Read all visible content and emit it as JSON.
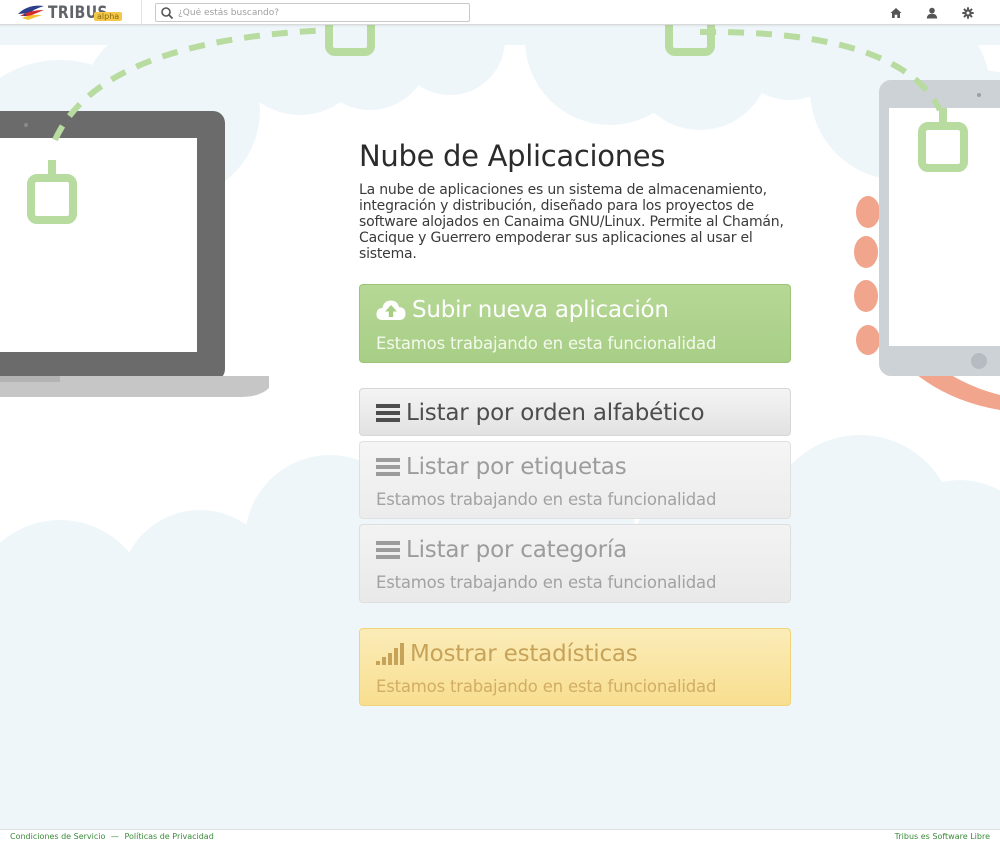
{
  "navbar": {
    "brand_name": "TRIBUS",
    "brand_badge": "alpha",
    "search_placeholder": "¿Qué estás buscando?",
    "icons": [
      "home-icon",
      "user-icon",
      "gear-icon"
    ]
  },
  "main": {
    "title": "Nube de Aplicaciones",
    "description": "La nube de aplicaciones es un sistema de almacenamiento, integración y distribución, diseñado para los proyectos de software alojados en Canaima GNU/Linux. Permite al Chamán, Cacique y Guerrero empoderar sus aplicaciones al usar el sistema.",
    "tiles": [
      {
        "label": "Subir nueva aplicación",
        "subtitle": "Estamos trabajando en esta funcionalidad",
        "icon": "cloud-upload-icon",
        "color": "#a8ce86"
      },
      {
        "label": "Listar por orden alfabético",
        "icon": "list-icon",
        "color": "#e8e8e8"
      },
      {
        "label": "Listar por etiquetas",
        "subtitle": "Estamos trabajando en esta funcionalidad",
        "icon": "list-icon",
        "color": "#ececec"
      },
      {
        "label": "Listar por categoría",
        "subtitle": "Estamos trabajando en esta funcionalidad",
        "icon": "list-icon",
        "color": "#ececec"
      },
      {
        "label": "Mostrar estadísticas",
        "subtitle": "Estamos trabajando en esta funcionalidad",
        "icon": "signal-bars-icon",
        "color": "#f9e29a"
      }
    ]
  },
  "footer": {
    "terms": "Condiciones de Servicio",
    "separator": "—",
    "privacy": "Políticas de Privacidad",
    "right": "Tribus es Software Libre"
  },
  "colors": {
    "cloud": "#eef6fa",
    "accent_green": "#b8dba0",
    "link_green": "#3b8a3b"
  }
}
